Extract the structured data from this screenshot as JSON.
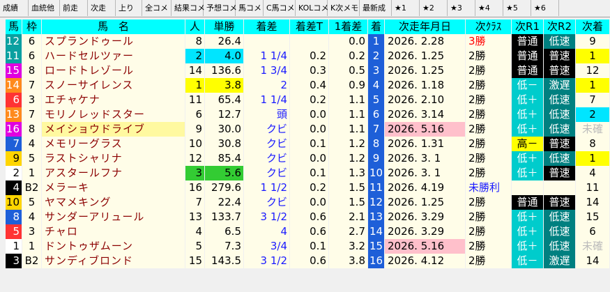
{
  "tabs": [
    "成績",
    "血統他",
    "前走",
    "次走",
    "上り",
    "全コメ",
    "結果コメ",
    "予想コメ",
    "馬コメ",
    "C馬コメ",
    "KOLコメ",
    "K次メモ",
    "最新成",
    "★1",
    "★2",
    "★3",
    "★4",
    "★5",
    "★6"
  ],
  "headers": [
    "馬",
    "枠",
    "馬　名",
    "人",
    "単勝",
    "着差",
    "着差T",
    "1着差",
    "着",
    "次走年月日",
    "次ｸﾗｽ",
    "次R1",
    "次R2",
    "次着"
  ],
  "rows": [
    {
      "uma": "12",
      "waku": "6",
      "name": "スプランドゥール",
      "nin": "8",
      "tan": "26.4",
      "chakusa": "",
      "chakusaT": "",
      "first": "0.0",
      "chaku": "1",
      "date": "2026. 2.28",
      "cls": "3勝",
      "r1": "普通",
      "r2": "低速",
      "next": "9"
    },
    {
      "uma": "11",
      "waku": "6",
      "name": "ハードセルツァー",
      "nin": "2",
      "tan": "4.0",
      "chakusa": "1 1/4",
      "chakusaT": "0.2",
      "first": "0.2",
      "chaku": "2",
      "date": "2026. 1.25",
      "cls": "2勝",
      "r1": "普通",
      "r2": "普速",
      "next": "1"
    },
    {
      "uma": "15",
      "waku": "8",
      "name": "ロードトレゾール",
      "nin": "14",
      "tan": "136.6",
      "chakusa": "1 3/4",
      "chakusaT": "0.3",
      "first": "0.5",
      "chaku": "3",
      "date": "2026. 1.25",
      "cls": "2勝",
      "r1": "普通",
      "r2": "普速",
      "next": "12"
    },
    {
      "uma": "14",
      "waku": "7",
      "name": "スノーサイレンス",
      "nin": "1",
      "tan": "3.8",
      "chakusa": "2",
      "chakusaT": "0.4",
      "first": "0.9",
      "chaku": "4",
      "date": "2026. 1.18",
      "cls": "2勝",
      "r1": "低－",
      "r2": "激遅",
      "next": "1"
    },
    {
      "uma": "6",
      "waku": "3",
      "name": "エチャケナ",
      "nin": "11",
      "tan": "65.4",
      "chakusa": "1 1/4",
      "chakusaT": "0.2",
      "first": "1.1",
      "chaku": "5",
      "date": "2026. 2.10",
      "cls": "2勝",
      "r1": "低＋",
      "r2": "低速",
      "next": "7"
    },
    {
      "uma": "13",
      "waku": "7",
      "name": "モリノレッドスター",
      "nin": "6",
      "tan": "12.7",
      "chakusa": "頭",
      "chakusaT": "0.0",
      "first": "1.1",
      "chaku": "6",
      "date": "2026. 3.14",
      "cls": "2勝",
      "r1": "低＋",
      "r2": "低速",
      "next": "2"
    },
    {
      "uma": "16",
      "waku": "8",
      "name": "メイショウドライブ",
      "nin": "9",
      "tan": "30.0",
      "chakusa": "クビ",
      "chakusaT": "0.0",
      "first": "1.1",
      "chaku": "7",
      "date": "2026. 5.16",
      "cls": "2勝",
      "r1": "低＋",
      "r2": "低速",
      "next": "未確"
    },
    {
      "uma": "7",
      "waku": "4",
      "name": "メモリーグラス",
      "nin": "10",
      "tan": "30.8",
      "chakusa": "クビ",
      "chakusaT": "0.1",
      "first": "1.2",
      "chaku": "8",
      "date": "2026. 1.31",
      "cls": "2勝",
      "r1": "高－",
      "r2": "普速",
      "next": "8"
    },
    {
      "uma": "9",
      "waku": "5",
      "name": "ラストシャリナ",
      "nin": "12",
      "tan": "85.4",
      "chakusa": "クビ",
      "chakusaT": "0.0",
      "first": "1.2",
      "chaku": "9",
      "date": "2026. 3. 1",
      "cls": "2勝",
      "r1": "低＋",
      "r2": "低速",
      "next": "1"
    },
    {
      "uma": "2",
      "waku": "1",
      "name": "アスタールフナ",
      "nin": "3",
      "tan": "5.6",
      "chakusa": "クビ",
      "chakusaT": "0.1",
      "first": "1.3",
      "chaku": "10",
      "date": "2026. 3. 1",
      "cls": "2勝",
      "r1": "低＋",
      "r2": "普速",
      "next": "4"
    },
    {
      "uma": "4",
      "waku": "B2",
      "name": "メラーキ",
      "nin": "16",
      "tan": "279.6",
      "chakusa": "1 1/2",
      "chakusaT": "0.2",
      "first": "1.5",
      "chaku": "11",
      "date": "2026. 4.19",
      "cls": "未勝利",
      "r1": "",
      "r2": "",
      "next": "11"
    },
    {
      "uma": "10",
      "waku": "5",
      "name": "ヤマメキング",
      "nin": "7",
      "tan": "22.4",
      "chakusa": "クビ",
      "chakusaT": "0.0",
      "first": "1.5",
      "chaku": "12",
      "date": "2026. 1.25",
      "cls": "2勝",
      "r1": "普通",
      "r2": "普速",
      "next": "14"
    },
    {
      "uma": "8",
      "waku": "4",
      "name": "サンダーアリュール",
      "nin": "13",
      "tan": "133.7",
      "chakusa": "3 1/2",
      "chakusaT": "0.6",
      "first": "2.1",
      "chaku": "13",
      "date": "2026. 3.29",
      "cls": "2勝",
      "r1": "低＋",
      "r2": "低速",
      "next": "15"
    },
    {
      "uma": "5",
      "waku": "3",
      "name": "チャロ",
      "nin": "4",
      "tan": "6.5",
      "chakusa": "4",
      "chakusaT": "0.6",
      "first": "2.7",
      "chaku": "14",
      "date": "2026. 3.29",
      "cls": "2勝",
      "r1": "低＋",
      "r2": "低速",
      "next": "6"
    },
    {
      "uma": "1",
      "waku": "1",
      "name": "ドントゥザムーン",
      "nin": "5",
      "tan": "7.3",
      "chakusa": "3/4",
      "chakusaT": "0.1",
      "first": "3.2",
      "chaku": "15",
      "date": "2026. 5.16",
      "cls": "2勝",
      "r1": "低＋",
      "r2": "低速",
      "next": "未確"
    },
    {
      "uma": "3",
      "waku": "B2",
      "name": "サンディブロンド",
      "nin": "15",
      "tan": "143.5",
      "chakusa": "3 1/2",
      "chakusaT": "0.6",
      "first": "3.8",
      "chaku": "16",
      "date": "2026. 4.12",
      "cls": "2勝",
      "r1": "低－",
      "r2": "激遅",
      "next": "14"
    }
  ],
  "colors": {
    "header_bg": "#00ffff",
    "body_bg": "#fffde8",
    "chaku_bg": "#1e5fd8",
    "name_color": "#8b0000",
    "nin_yellow": "#ffff00",
    "nin_cyan": "#00e5ff",
    "nin_green": "#33cc33",
    "date_pink": "#ffc0cb",
    "cls_red": "#ff0000",
    "cls_blue": "#1a1aff",
    "r_black": "#000000",
    "r_cyan": "#00cccc",
    "r_yellow": "#ffff00",
    "r_teal": "#008080",
    "next_yellow": "#ffff00",
    "next_cyan": "#00e5ff",
    "unconfirmed": "#bbbbbb"
  },
  "uma_colors": {
    "12": "#0aa0a0",
    "11": "#0aa0a0",
    "15": "#e000e0",
    "14": "#ff8a1c",
    "6": "#ff3333",
    "13": "#ff8a1c",
    "16": "#e000e0",
    "7": "#1e5fd8",
    "9": "#ffd500",
    "2": "#ffffff",
    "4": "#000000",
    "10": "#ffd500",
    "8": "#1e5fd8",
    "5": "#ff3333",
    "1": "#ffffff",
    "3": "#000000"
  }
}
